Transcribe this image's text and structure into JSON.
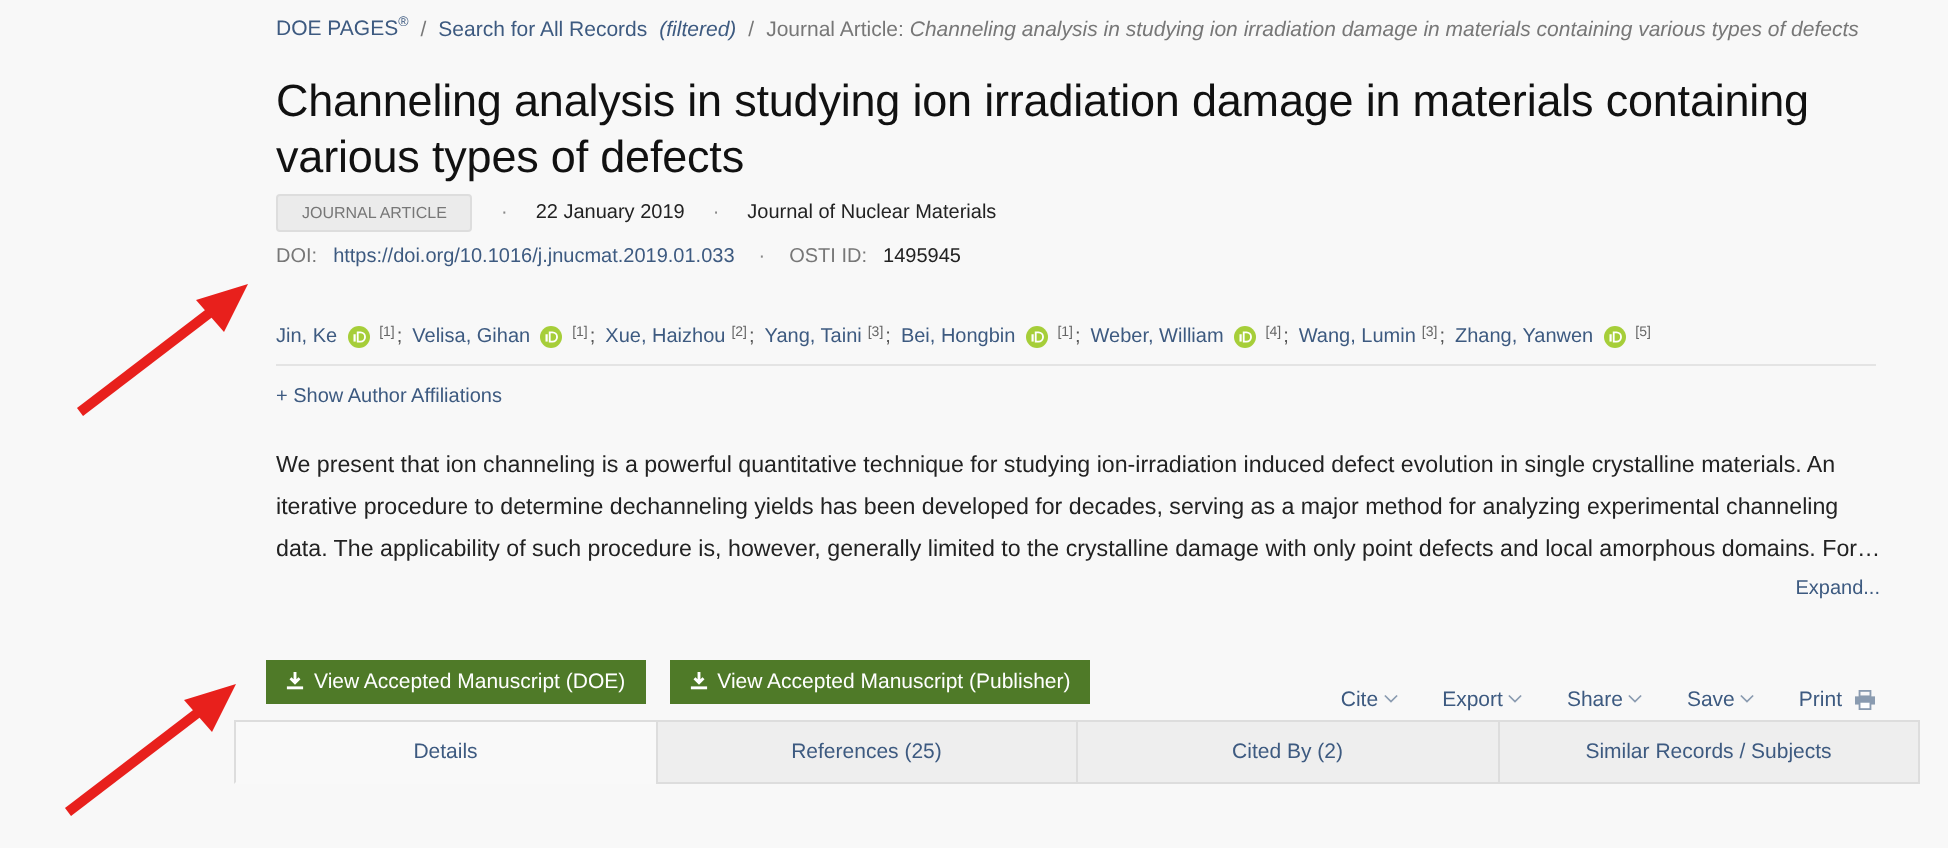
{
  "breadcrumb": [
    {
      "text": "DOE PAGES$^{®}$",
      "kind": "link"
    },
    {
      "text": "/",
      "kind": "sep"
    },
    {
      "text": "Search for All Records",
      "kind": "link"
    },
    {
      "text": "(filtered)",
      "kind": "note"
    },
    {
      "text": "/",
      "kind": "sep"
    },
    {
      "text": "Journal Article: *Channeling analysis in studying ion irradiation damage in materials containing various types of defects*",
      "kind": "current"
    }
  ],
  "title": "Channeling analysis in studying ion irradiation damage in materials containing various types of defects",
  "meta": {
    "type_badge": "JOURNAL ARTICLE",
    "dot_1": "·",
    "date": "22 January 2019",
    "dot_2": "·",
    "journal": "Journal of Nuclear Materials",
    "doi_label": "DOI:",
    "doi": "https://doi.org/10.1016/j.jnucmat.2019.01.033",
    "dot_3": "·",
    "osti_label": "OSTI ID:",
    "osti_id": "1495945"
  },
  "authors": [
    {
      "name": "Jin, Ke",
      "orcid": true,
      "affiliation": "[1]",
      "separator": ";"
    },
    {
      "name": "Velisa, Gihan",
      "orcid": true,
      "affiliation": "[1]",
      "separator": ";"
    },
    {
      "name": "Xue, Haizhou",
      "orcid": false,
      "affiliation": "[2]",
      "separator": ";"
    },
    {
      "name": "Yang, Taini",
      "orcid": false,
      "affiliation": "[3]",
      "separator": ";"
    },
    {
      "name": "Bei, Hongbin",
      "orcid": true,
      "affiliation": "[1]",
      "separator": ";"
    },
    {
      "name": "Weber, William",
      "orcid": true,
      "affiliation": "[4]",
      "separator": ";"
    },
    {
      "name": "Wang, Lumin",
      "orcid": false,
      "affiliation": "[3]",
      "separator": ";"
    },
    {
      "name": "Zhang, Yanwen",
      "orcid": true,
      "affiliation": "[5]"
    }
  ],
  "show_affiliations": "+ Show Author Affiliations",
  "abstract": "We present that ion channeling is a powerful quantitative technique for studying ion-irradiation induced defect evolution in single crystalline materials. An iterative procedure to determine dechanneling yields has been developed for decades, serving as a major method for analyzing experimental channeling data. The applicability of such procedure is, however, generally limited to the crystalline damage with only point defects and local amorphous domains. For…",
  "expand": "Expand...",
  "download_buttons": [
    "View Accepted Manuscript (DOE)",
    "View Accepted Manuscript (Publisher)"
  ],
  "actions": [
    {
      "label": "Cite",
      "kind": "menu"
    },
    {
      "label": "Export",
      "kind": "menu"
    },
    {
      "label": "Share",
      "kind": "menu"
    },
    {
      "label": "Save",
      "kind": "menu"
    },
    {
      "label": "Print",
      "kind": "print"
    }
  ],
  "tabs": [
    {
      "label": "Details",
      "selected": true
    },
    {
      "label": "References (25)",
      "selected": false
    },
    {
      "label": "Cited By (2)",
      "selected": false
    },
    {
      "label": "Similar Records / Subjects",
      "selected": false
    }
  ]
}
